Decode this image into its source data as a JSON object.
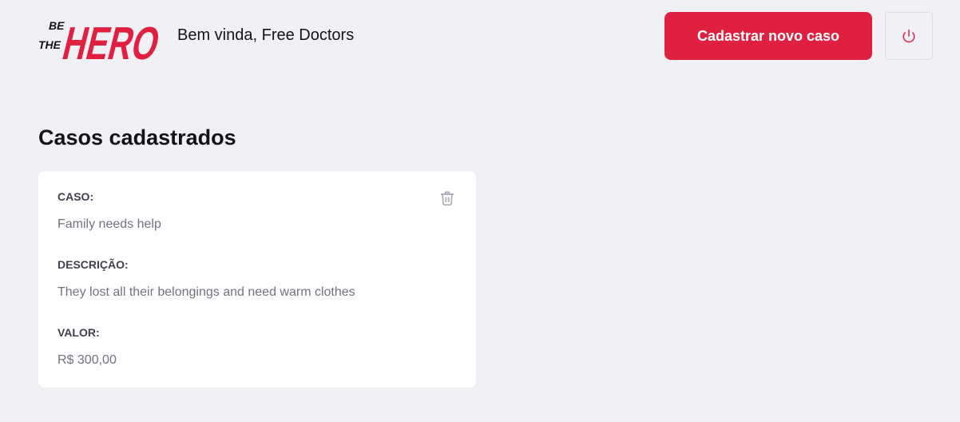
{
  "header": {
    "logo_icon": "be-the-hero-logo",
    "logo_line1": "BE",
    "logo_line2": "THE",
    "logo_main": "HERO",
    "welcome_text": "Bem vinda, Free Doctors",
    "new_case_label": "Cadastrar novo caso",
    "logout_icon": "power-icon"
  },
  "main": {
    "section_title": "Casos cadastrados",
    "cases": [
      {
        "case_label": "CASO:",
        "case_value": "Family needs help",
        "description_label": "DESCRIÇÃO:",
        "description_value": "They lost all their belongings and need warm clothes",
        "value_label": "VALOR:",
        "value_value": "R$ 300,00",
        "delete_icon": "trash-icon"
      }
    ]
  },
  "colors": {
    "accent": "#e02041",
    "background": "#f0f0f5",
    "card": "#ffffff",
    "label": "#41414d",
    "value": "#737380",
    "icon_gray": "#a8a8b3"
  }
}
